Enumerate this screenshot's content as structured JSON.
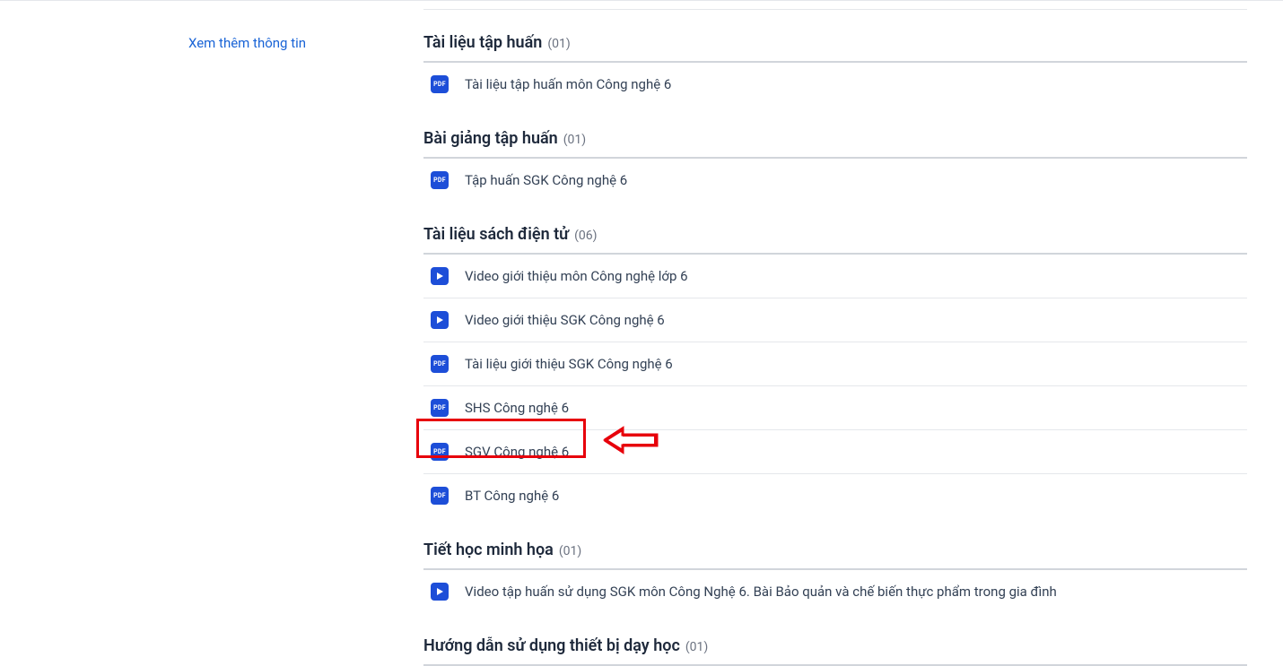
{
  "sidebar": {
    "more_info": "Xem thêm thông tin"
  },
  "sections": [
    {
      "title": "Tài liệu tập huấn",
      "count": "(01)",
      "items": [
        {
          "type": "pdf",
          "label": "Tài liệu tập huấn môn Công nghệ 6"
        }
      ]
    },
    {
      "title": "Bài giảng tập huấn",
      "count": "(01)",
      "items": [
        {
          "type": "pdf",
          "label": "Tập huấn SGK Công nghệ 6"
        }
      ]
    },
    {
      "title": "Tài liệu sách điện tử",
      "count": "(06)",
      "items": [
        {
          "type": "video",
          "label": "Video giới thiệu môn Công nghệ lớp 6"
        },
        {
          "type": "video",
          "label": "Video giới thiệu SGK Công nghệ 6"
        },
        {
          "type": "pdf",
          "label": "Tài liệu giới thiệu SGK Công nghệ 6"
        },
        {
          "type": "pdf",
          "label": "SHS Công nghệ 6"
        },
        {
          "type": "pdf",
          "label": "SGV Công nghệ 6"
        },
        {
          "type": "pdf",
          "label": "BT Công nghệ 6"
        }
      ]
    },
    {
      "title": "Tiết học minh họa",
      "count": "(01)",
      "items": [
        {
          "type": "video",
          "label": "Video tập huấn sử dụng SGK môn Công Nghệ 6. Bài Bảo quản và chế biến thực phẩm trong gia đình"
        }
      ]
    },
    {
      "title": "Hướng dẫn sử dụng thiết bị dạy học",
      "count": "(01)",
      "items": []
    }
  ],
  "icon_text": {
    "pdf": "PDF"
  }
}
